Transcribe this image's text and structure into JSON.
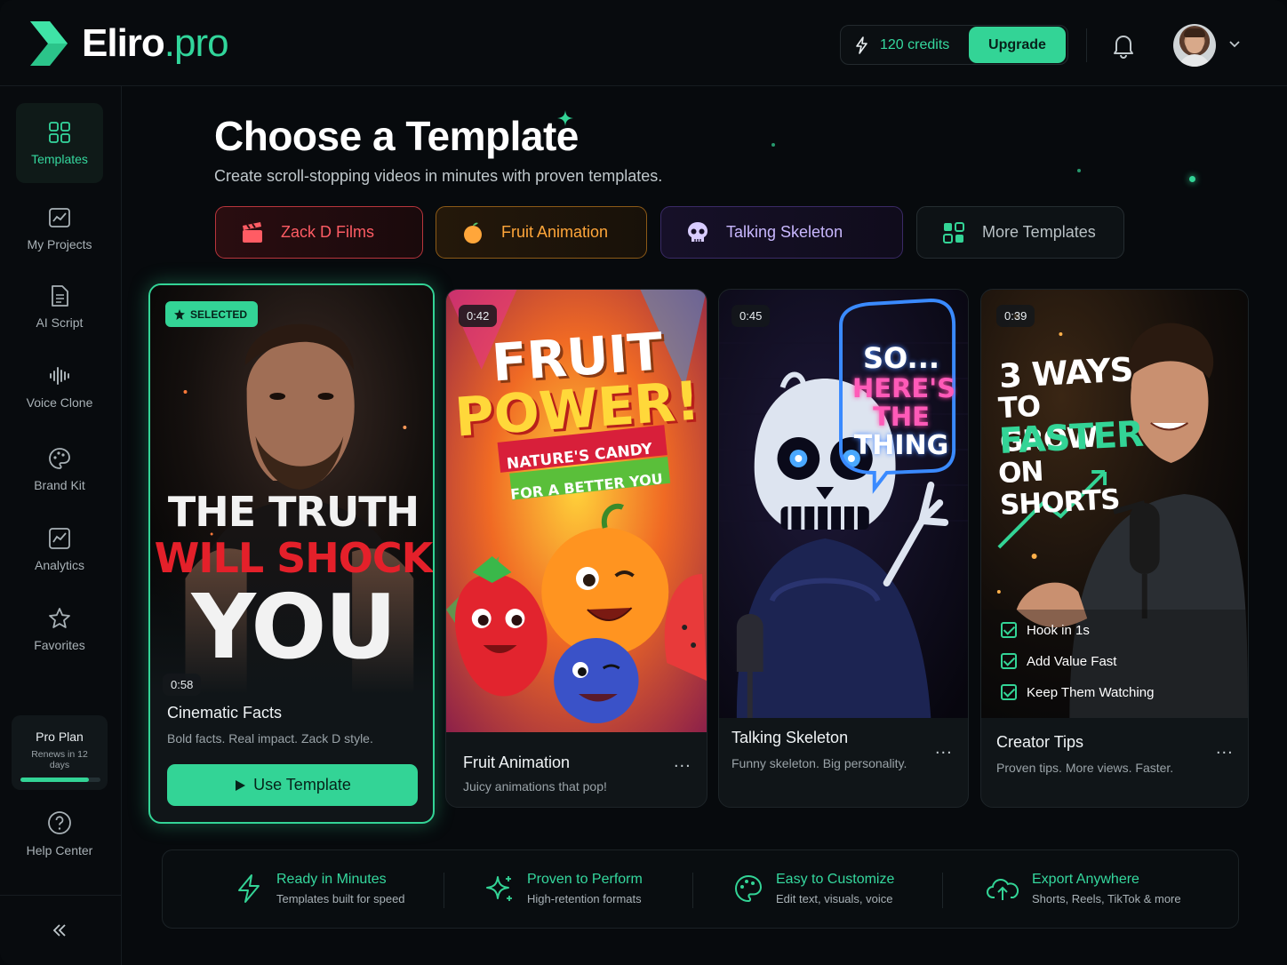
{
  "app": {
    "logo_main": "Eliro",
    "logo_suffix": ".pro"
  },
  "header": {
    "credits": "120 credits",
    "upgrade_label": "Upgrade"
  },
  "sidebar": {
    "items": [
      {
        "label": "Templates",
        "icon": "grid-icon",
        "active": true
      },
      {
        "label": "My Projects",
        "icon": "chart-folder-icon"
      },
      {
        "label": "AI Script",
        "icon": "document-icon"
      },
      {
        "label": "Voice Clone",
        "icon": "waveform-icon"
      },
      {
        "label": "Brand Kit",
        "icon": "palette-icon"
      },
      {
        "label": "Analytics",
        "icon": "analytics-icon"
      },
      {
        "label": "Favorites",
        "icon": "star-icon"
      }
    ],
    "plan": {
      "title": "Pro Plan",
      "renewal": "Renews in 12 days",
      "progress": 0.85
    },
    "help_label": "Help Center"
  },
  "main": {
    "title": "Choose a Template",
    "subtitle": "Create scroll-stopping videos in minutes with proven templates.",
    "pills": [
      {
        "label": "Zack D Films",
        "icon": "clapperboard-icon",
        "color": "#ff5c64"
      },
      {
        "label": "Fruit Animation",
        "icon": "orange-icon",
        "color": "#ffa63a"
      },
      {
        "label": "Talking Skeleton",
        "icon": "skull-icon",
        "color": "#c9b8ff"
      },
      {
        "label": "More Templates",
        "icon": "grid-icon",
        "color": "#b8c0c4"
      }
    ],
    "cards": [
      {
        "selected_label": "SELECTED",
        "duration": "0:58",
        "name": "Cinematic Facts",
        "desc": "Bold facts. Real impact. Zack D style.",
        "button": "Use Template",
        "art_lines": [
          "THE TRUTH",
          "WILL SHOCK",
          "YOU"
        ]
      },
      {
        "duration": "0:42",
        "name": "Fruit Animation",
        "desc": "Juicy animations that pop!",
        "more": "...",
        "art_lines": [
          "FRUIT",
          "POWER!",
          "NATURE'S CANDY",
          "FOR A BETTER YOU"
        ]
      },
      {
        "duration": "0:45",
        "name": "Talking Skeleton",
        "desc": "Funny skeleton. Big personality.",
        "more": "...",
        "art_lines": [
          "SO...",
          "HERE'S",
          "THE",
          "THING"
        ]
      },
      {
        "duration": "0:39",
        "name": "Creator Tips",
        "desc": "Proven tips. More views. Faster.",
        "more": "...",
        "art_lines": [
          "3 WAYS",
          "TO GROW",
          "FASTER",
          "ON SHORTS"
        ],
        "checks": [
          "Hook in 1s",
          "Add Value Fast",
          "Keep Them Watching"
        ]
      }
    ]
  },
  "features": [
    {
      "title": "Ready in Minutes",
      "desc": "Templates built for speed",
      "icon": "lightning-icon"
    },
    {
      "title": "Proven to Perform",
      "desc": "High-retention formats",
      "icon": "sparkles-icon"
    },
    {
      "title": "Easy to Customize",
      "desc": "Edit text, visuals, voice",
      "icon": "palette-icon"
    },
    {
      "title": "Export Anywhere",
      "desc": "Shorts, Reels, TikTok & more",
      "icon": "cloud-upload-icon"
    }
  ],
  "colors": {
    "accent": "#33d496",
    "background": "#070a0d"
  }
}
